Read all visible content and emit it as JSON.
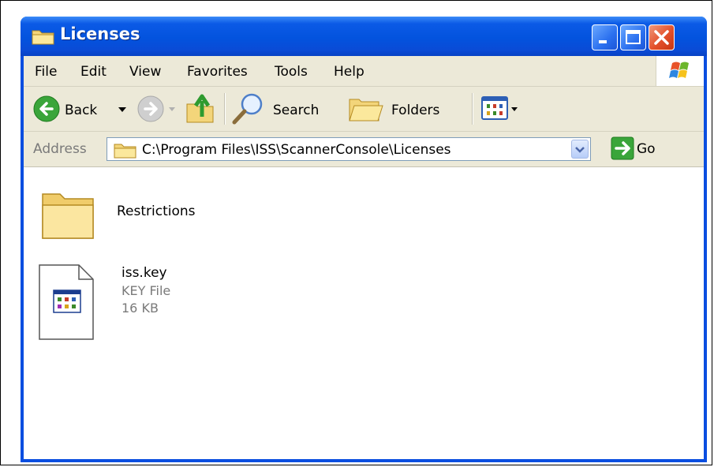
{
  "window": {
    "title": "Licenses"
  },
  "menu": {
    "items": [
      "File",
      "Edit",
      "View",
      "Favorites",
      "Tools",
      "Help"
    ]
  },
  "toolbar": {
    "back_label": "Back",
    "search_label": "Search",
    "folders_label": "Folders"
  },
  "address": {
    "label": "Address",
    "value": "C:\\Program Files\\ISS\\ScannerConsole\\Licenses",
    "go_label": "Go"
  },
  "files": [
    {
      "name": "Restrictions",
      "type": "folder"
    },
    {
      "name": "iss.key",
      "type_label": "KEY File",
      "size": "16 KB"
    }
  ],
  "colors": {
    "titlebar": "#0353de",
    "chrome": "#ece9d8",
    "close_button": "#e3502b"
  }
}
